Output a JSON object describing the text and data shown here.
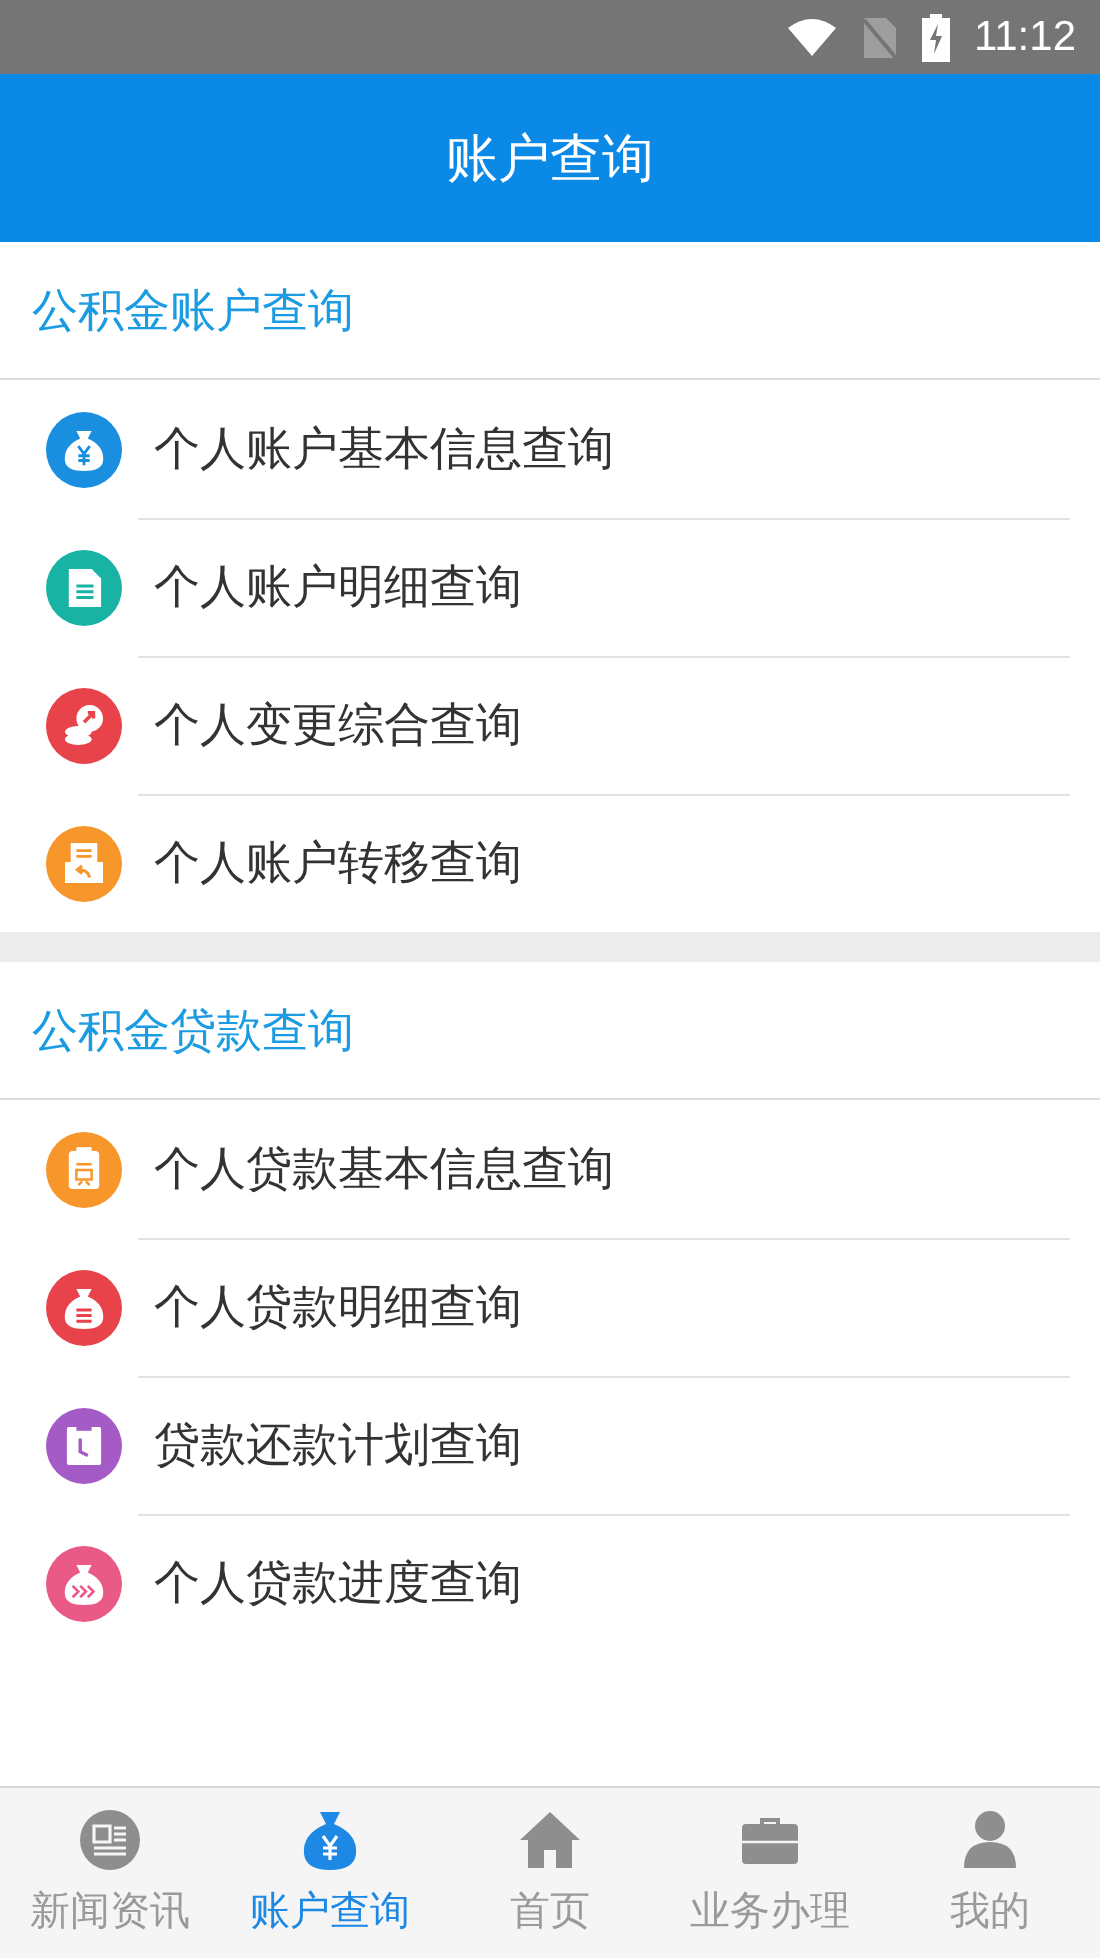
{
  "status_bar": {
    "time": "11:12"
  },
  "header": {
    "title": "账户查询"
  },
  "sections": [
    {
      "title": "公积金账户查询",
      "items": [
        {
          "label": "个人账户基本信息查询",
          "kind": "moneybag",
          "color": "#1a8fe0"
        },
        {
          "label": "个人账户明细查询",
          "kind": "document",
          "color": "#19b3a4"
        },
        {
          "label": "个人变更综合查询",
          "kind": "coins",
          "color": "#e8434a"
        },
        {
          "label": "个人账户转移查询",
          "kind": "transfer",
          "color": "#f7962a"
        }
      ]
    },
    {
      "title": "公积金贷款查询",
      "items": [
        {
          "label": "个人贷款基本信息查询",
          "kind": "loan",
          "color": "#f7962a"
        },
        {
          "label": "个人贷款明细查询",
          "kind": "listbag",
          "color": "#e8434a"
        },
        {
          "label": "贷款还款计划查询",
          "kind": "clock",
          "color": "#a55bc6"
        },
        {
          "label": "个人贷款进度查询",
          "kind": "arrowbag",
          "color": "#ea5a86"
        }
      ]
    }
  ],
  "tabs": [
    {
      "label": "新闻资讯",
      "kind": "news",
      "selected": false
    },
    {
      "label": "账户查询",
      "kind": "moneybag",
      "selected": true
    },
    {
      "label": "首页",
      "kind": "home",
      "selected": false
    },
    {
      "label": "业务办理",
      "kind": "briefcase",
      "selected": false
    },
    {
      "label": "我的",
      "kind": "person",
      "selected": false
    }
  ]
}
